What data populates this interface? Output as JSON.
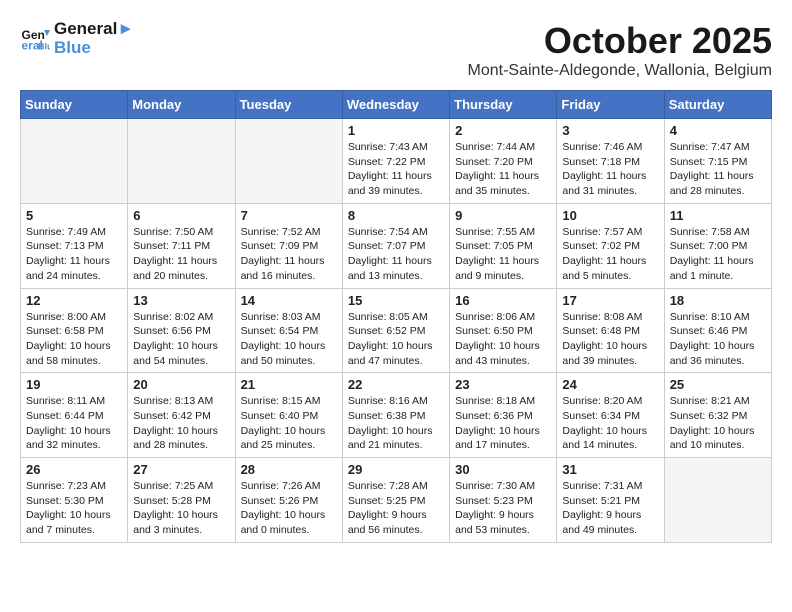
{
  "header": {
    "logo_line1": "General",
    "logo_line2": "Blue",
    "month": "October 2025",
    "location": "Mont-Sainte-Aldegonde, Wallonia, Belgium"
  },
  "weekdays": [
    "Sunday",
    "Monday",
    "Tuesday",
    "Wednesday",
    "Thursday",
    "Friday",
    "Saturday"
  ],
  "weeks": [
    [
      {
        "day": "",
        "info": ""
      },
      {
        "day": "",
        "info": ""
      },
      {
        "day": "",
        "info": ""
      },
      {
        "day": "1",
        "info": "Sunrise: 7:43 AM\nSunset: 7:22 PM\nDaylight: 11 hours\nand 39 minutes."
      },
      {
        "day": "2",
        "info": "Sunrise: 7:44 AM\nSunset: 7:20 PM\nDaylight: 11 hours\nand 35 minutes."
      },
      {
        "day": "3",
        "info": "Sunrise: 7:46 AM\nSunset: 7:18 PM\nDaylight: 11 hours\nand 31 minutes."
      },
      {
        "day": "4",
        "info": "Sunrise: 7:47 AM\nSunset: 7:15 PM\nDaylight: 11 hours\nand 28 minutes."
      }
    ],
    [
      {
        "day": "5",
        "info": "Sunrise: 7:49 AM\nSunset: 7:13 PM\nDaylight: 11 hours\nand 24 minutes."
      },
      {
        "day": "6",
        "info": "Sunrise: 7:50 AM\nSunset: 7:11 PM\nDaylight: 11 hours\nand 20 minutes."
      },
      {
        "day": "7",
        "info": "Sunrise: 7:52 AM\nSunset: 7:09 PM\nDaylight: 11 hours\nand 16 minutes."
      },
      {
        "day": "8",
        "info": "Sunrise: 7:54 AM\nSunset: 7:07 PM\nDaylight: 11 hours\nand 13 minutes."
      },
      {
        "day": "9",
        "info": "Sunrise: 7:55 AM\nSunset: 7:05 PM\nDaylight: 11 hours\nand 9 minutes."
      },
      {
        "day": "10",
        "info": "Sunrise: 7:57 AM\nSunset: 7:02 PM\nDaylight: 11 hours\nand 5 minutes."
      },
      {
        "day": "11",
        "info": "Sunrise: 7:58 AM\nSunset: 7:00 PM\nDaylight: 11 hours\nand 1 minute."
      }
    ],
    [
      {
        "day": "12",
        "info": "Sunrise: 8:00 AM\nSunset: 6:58 PM\nDaylight: 10 hours\nand 58 minutes."
      },
      {
        "day": "13",
        "info": "Sunrise: 8:02 AM\nSunset: 6:56 PM\nDaylight: 10 hours\nand 54 minutes."
      },
      {
        "day": "14",
        "info": "Sunrise: 8:03 AM\nSunset: 6:54 PM\nDaylight: 10 hours\nand 50 minutes."
      },
      {
        "day": "15",
        "info": "Sunrise: 8:05 AM\nSunset: 6:52 PM\nDaylight: 10 hours\nand 47 minutes."
      },
      {
        "day": "16",
        "info": "Sunrise: 8:06 AM\nSunset: 6:50 PM\nDaylight: 10 hours\nand 43 minutes."
      },
      {
        "day": "17",
        "info": "Sunrise: 8:08 AM\nSunset: 6:48 PM\nDaylight: 10 hours\nand 39 minutes."
      },
      {
        "day": "18",
        "info": "Sunrise: 8:10 AM\nSunset: 6:46 PM\nDaylight: 10 hours\nand 36 minutes."
      }
    ],
    [
      {
        "day": "19",
        "info": "Sunrise: 8:11 AM\nSunset: 6:44 PM\nDaylight: 10 hours\nand 32 minutes."
      },
      {
        "day": "20",
        "info": "Sunrise: 8:13 AM\nSunset: 6:42 PM\nDaylight: 10 hours\nand 28 minutes."
      },
      {
        "day": "21",
        "info": "Sunrise: 8:15 AM\nSunset: 6:40 PM\nDaylight: 10 hours\nand 25 minutes."
      },
      {
        "day": "22",
        "info": "Sunrise: 8:16 AM\nSunset: 6:38 PM\nDaylight: 10 hours\nand 21 minutes."
      },
      {
        "day": "23",
        "info": "Sunrise: 8:18 AM\nSunset: 6:36 PM\nDaylight: 10 hours\nand 17 minutes."
      },
      {
        "day": "24",
        "info": "Sunrise: 8:20 AM\nSunset: 6:34 PM\nDaylight: 10 hours\nand 14 minutes."
      },
      {
        "day": "25",
        "info": "Sunrise: 8:21 AM\nSunset: 6:32 PM\nDaylight: 10 hours\nand 10 minutes."
      }
    ],
    [
      {
        "day": "26",
        "info": "Sunrise: 7:23 AM\nSunset: 5:30 PM\nDaylight: 10 hours\nand 7 minutes."
      },
      {
        "day": "27",
        "info": "Sunrise: 7:25 AM\nSunset: 5:28 PM\nDaylight: 10 hours\nand 3 minutes."
      },
      {
        "day": "28",
        "info": "Sunrise: 7:26 AM\nSunset: 5:26 PM\nDaylight: 10 hours\nand 0 minutes."
      },
      {
        "day": "29",
        "info": "Sunrise: 7:28 AM\nSunset: 5:25 PM\nDaylight: 9 hours\nand 56 minutes."
      },
      {
        "day": "30",
        "info": "Sunrise: 7:30 AM\nSunset: 5:23 PM\nDaylight: 9 hours\nand 53 minutes."
      },
      {
        "day": "31",
        "info": "Sunrise: 7:31 AM\nSunset: 5:21 PM\nDaylight: 9 hours\nand 49 minutes."
      },
      {
        "day": "",
        "info": ""
      }
    ]
  ]
}
